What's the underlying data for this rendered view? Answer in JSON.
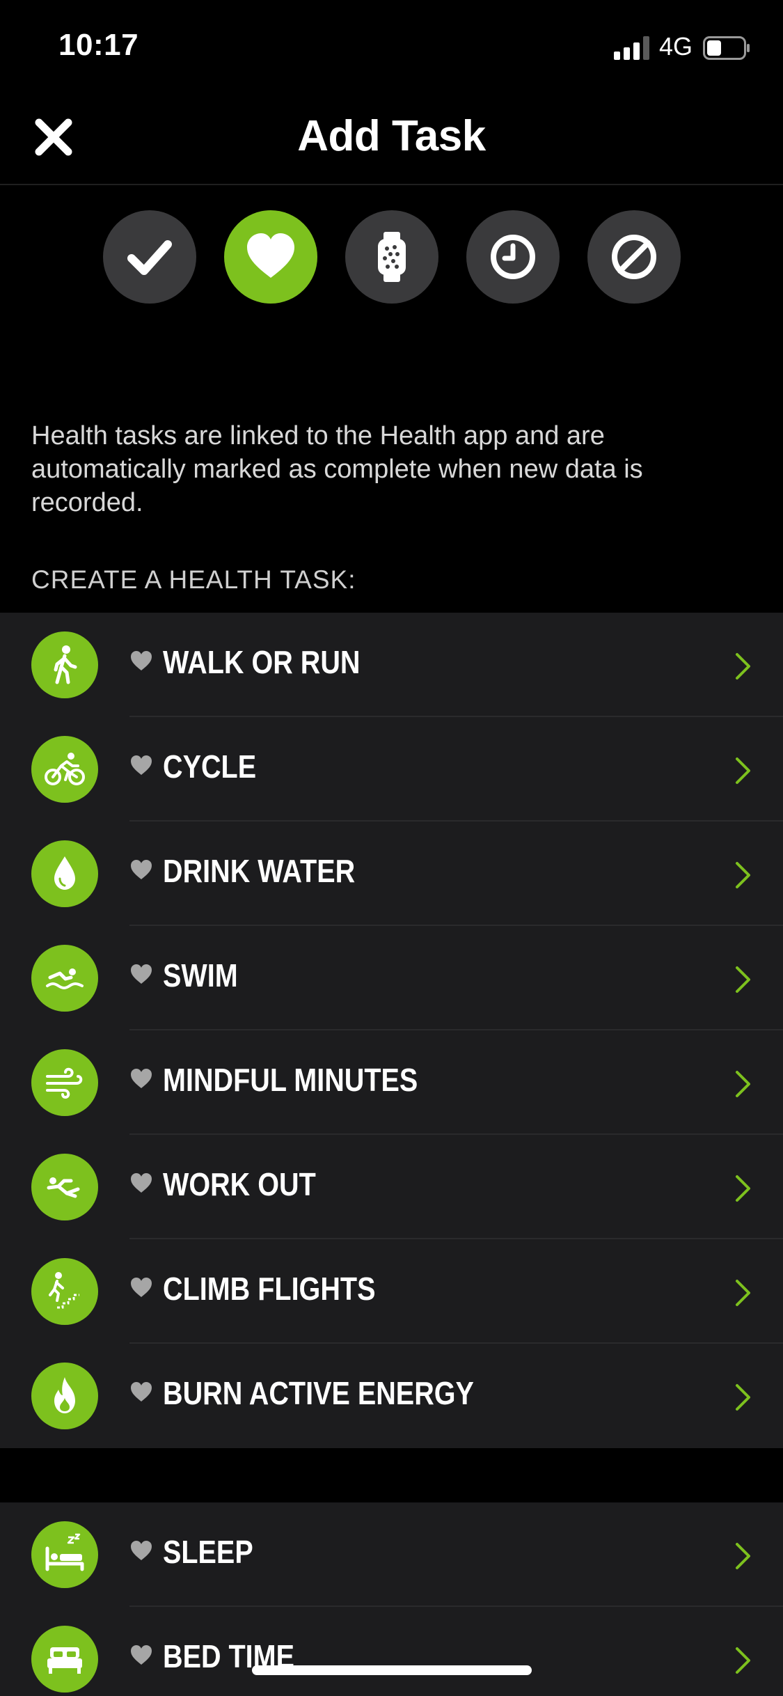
{
  "status_bar": {
    "time": "10:17",
    "network": "4G"
  },
  "nav": {
    "title": "Add Task",
    "close_icon": "close-icon"
  },
  "task_types": [
    {
      "name": "checkmark-icon",
      "active": false
    },
    {
      "name": "heart-icon",
      "active": true
    },
    {
      "name": "watch-icon",
      "active": false
    },
    {
      "name": "clock-icon",
      "active": false
    },
    {
      "name": "block-icon",
      "active": false
    }
  ],
  "description": "Health tasks are linked to the Health app and are automatically marked as complete when new data is recorded.",
  "section_header": "CREATE A HEALTH TASK:",
  "health_tasks": [
    {
      "label": "WALK OR RUN",
      "icon": "walk-icon"
    },
    {
      "label": "CYCLE",
      "icon": "bicycle-icon"
    },
    {
      "label": "DRINK WATER",
      "icon": "water-drop-icon"
    },
    {
      "label": "SWIM",
      "icon": "swim-icon"
    },
    {
      "label": "MINDFUL MINUTES",
      "icon": "wind-icon"
    },
    {
      "label": "WORK OUT",
      "icon": "workout-icon"
    },
    {
      "label": "CLIMB FLIGHTS",
      "icon": "stairs-icon"
    },
    {
      "label": "BURN ACTIVE ENERGY",
      "icon": "flame-icon"
    }
  ],
  "sleep_tasks": [
    {
      "label": "SLEEP",
      "icon": "sleep-bed-icon"
    },
    {
      "label": "BED TIME",
      "icon": "bed-icon"
    }
  ],
  "colors": {
    "accent": "#7dc11e",
    "inactive_button": "#3a3a3c",
    "row_background": "#1c1c1e",
    "background": "#000000"
  }
}
